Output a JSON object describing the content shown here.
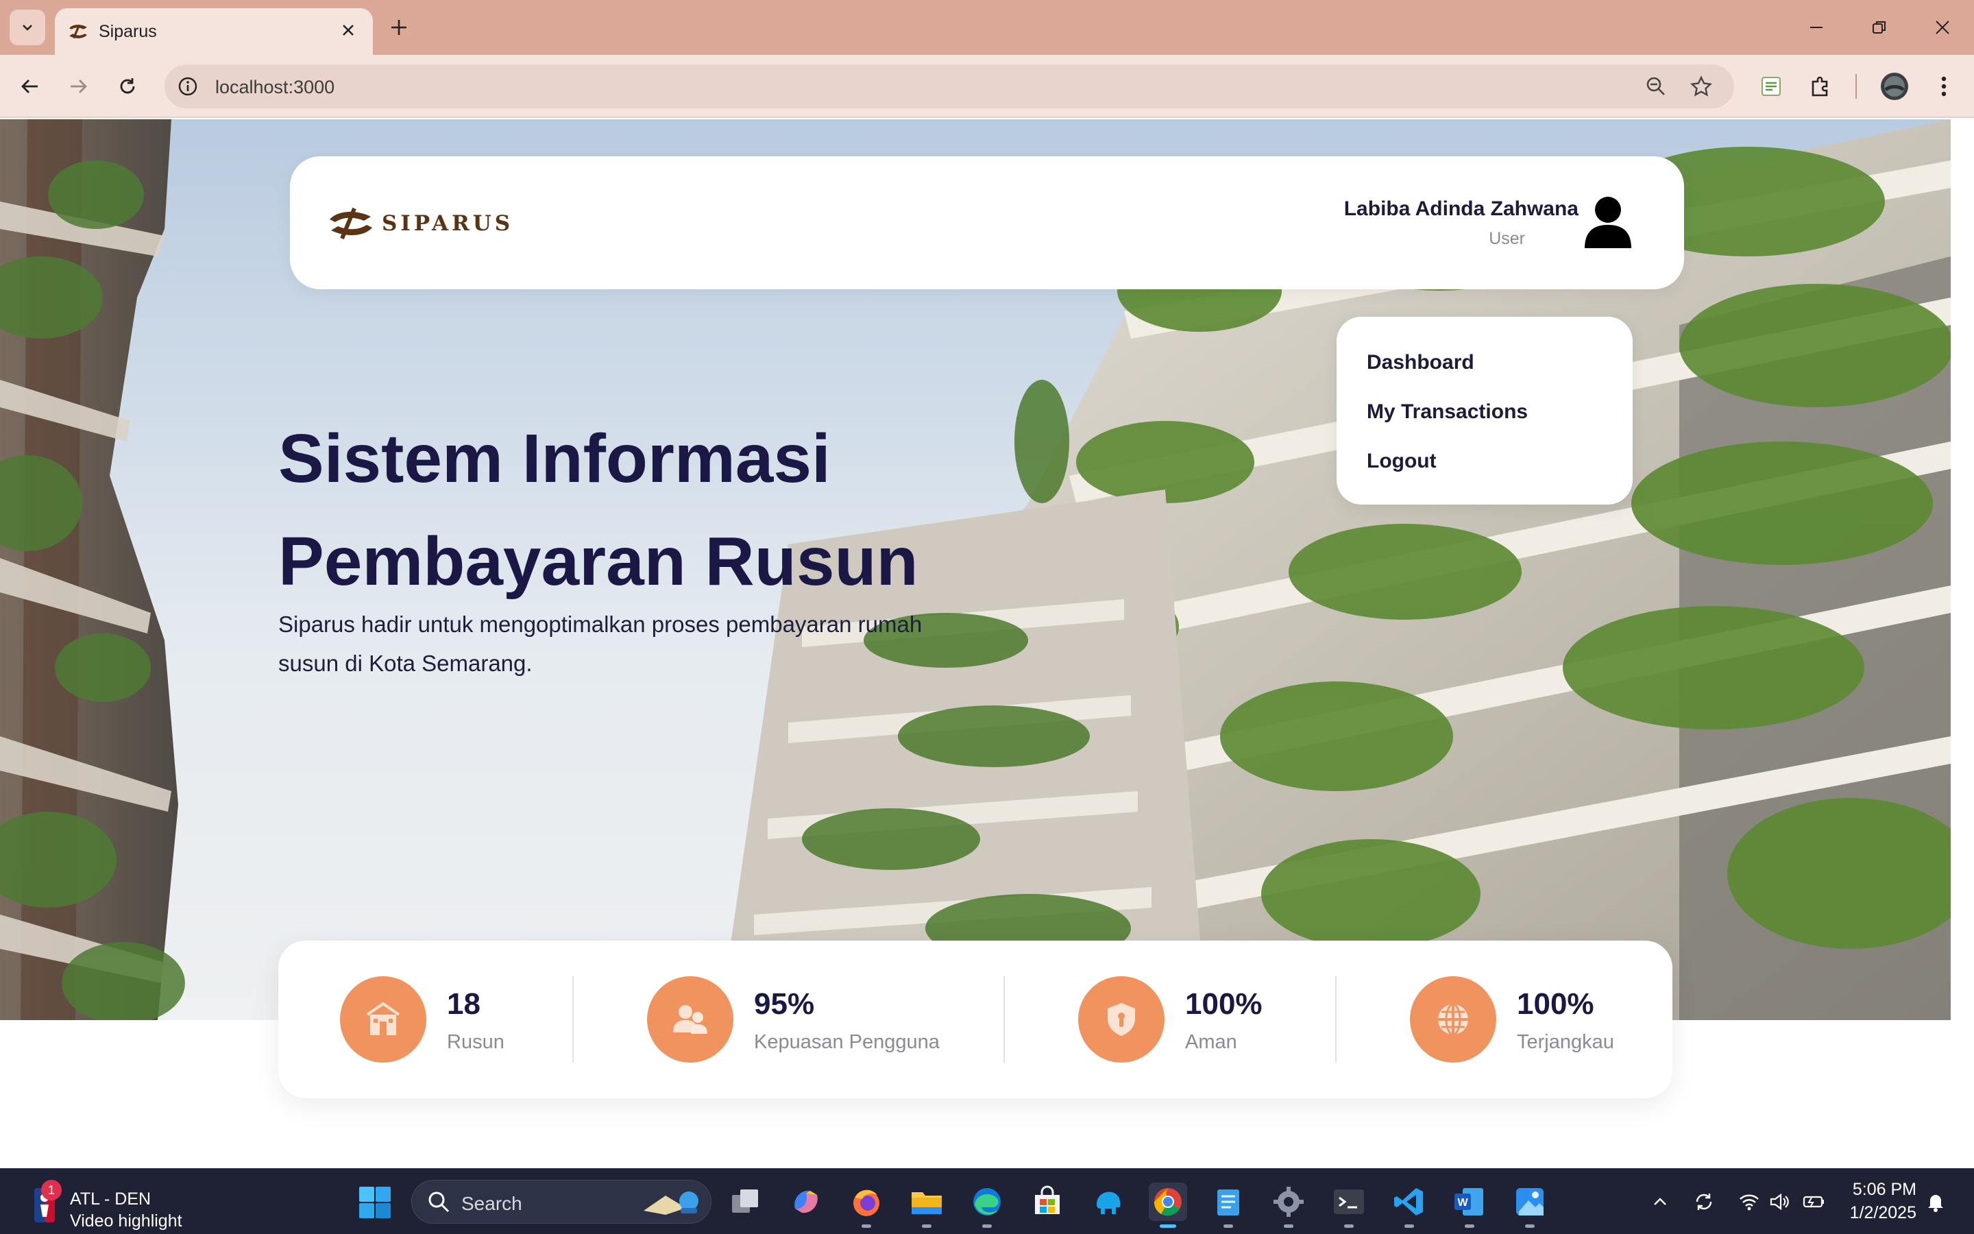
{
  "browser": {
    "tab_title": "Siparus",
    "url": "localhost:3000"
  },
  "header": {
    "brand": "SIPARUS",
    "user_name": "Labiba Adinda Zahwana",
    "user_role": "User"
  },
  "menu": {
    "items": [
      {
        "label": "Dashboard"
      },
      {
        "label": "My Transactions"
      },
      {
        "label": "Logout"
      }
    ]
  },
  "hero": {
    "title_line1": "Sistem Informasi",
    "title_line2": "Pembayaran Rusun",
    "subtitle": "Siparus hadir untuk mengoptimalkan proses pembayaran rumah susun di Kota Semarang."
  },
  "stats": [
    {
      "value": "18",
      "label": "Rusun",
      "icon": "building-icon"
    },
    {
      "value": "95%",
      "label": "Kepuasan Pengguna",
      "icon": "users-icon"
    },
    {
      "value": "100%",
      "label": "Aman",
      "icon": "shield-icon"
    },
    {
      "value": "100%",
      "label": "Terjangkau",
      "icon": "globe-icon"
    }
  ],
  "taskbar": {
    "news_badge": "1",
    "news_title": "ATL - DEN",
    "news_sub": "Video highlight",
    "search_placeholder": "Search",
    "time": "5:06 PM",
    "date": "1/2/2025"
  },
  "colors": {
    "accent": "#f0935f",
    "heading": "#1b1846",
    "brand": "#5a3415",
    "chrome": "#dba898"
  }
}
